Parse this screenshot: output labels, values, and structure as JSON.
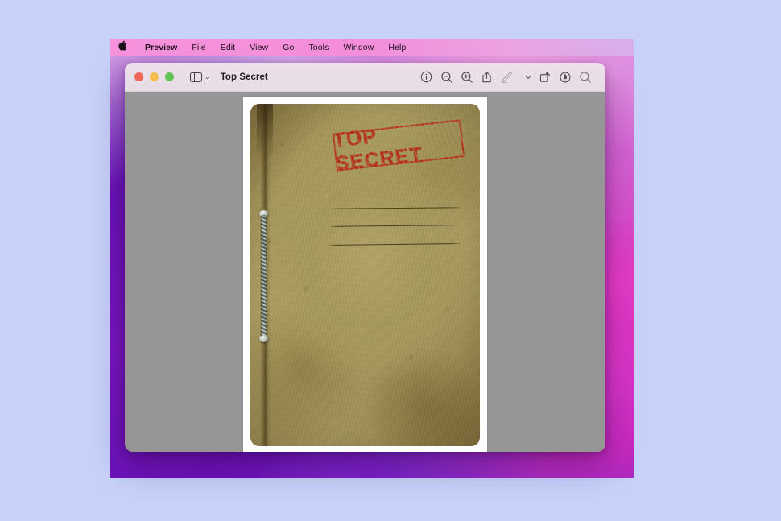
{
  "desktop": {
    "wallpaper_colors": {
      "outer_background": "#c7d1f9",
      "magenta": "#e03fd0",
      "violet": "#7a1cc6",
      "pink": "#f6a8e6"
    }
  },
  "menubar": {
    "apple_icon": "apple-logo-icon",
    "apple_glyph": "",
    "items": [
      {
        "label": "Preview",
        "bold": true
      },
      {
        "label": "File",
        "bold": false
      },
      {
        "label": "Edit",
        "bold": false
      },
      {
        "label": "View",
        "bold": false
      },
      {
        "label": "Go",
        "bold": false
      },
      {
        "label": "Tools",
        "bold": false
      },
      {
        "label": "Window",
        "bold": false
      },
      {
        "label": "Help",
        "bold": false
      }
    ]
  },
  "window": {
    "title": "Top Secret",
    "traffic_lights": {
      "close": "#f2655a",
      "minimize": "#f6bd4f",
      "zoom": "#61c454"
    },
    "sidebar_toggle": {
      "icon": "sidebar-icon",
      "chevron": "chevron-down-icon",
      "chevron_glyph": "⌄"
    },
    "toolbar": [
      {
        "name": "info-icon",
        "label": "Info",
        "disabled": false
      },
      {
        "name": "zoom-out-icon",
        "label": "Zoom Out",
        "disabled": false
      },
      {
        "name": "zoom-in-icon",
        "label": "Zoom In",
        "disabled": false
      },
      {
        "name": "share-icon",
        "label": "Share",
        "disabled": false
      },
      {
        "name": "markup-pen-icon",
        "label": "Markup",
        "disabled": true
      },
      {
        "name": "chevron-down-icon",
        "label": "More",
        "disabled": false
      },
      {
        "name": "rotate-icon",
        "label": "Rotate",
        "disabled": false
      },
      {
        "name": "annotate-icon",
        "label": "Annotate",
        "disabled": false
      },
      {
        "name": "search-icon",
        "label": "Search",
        "disabled": false
      }
    ],
    "viewer_background": "#969696"
  },
  "document": {
    "page_background": "#ffffff",
    "parchment_color": "#a89a5f",
    "stamp": {
      "text": "TOP SECRET",
      "color": "#b7231a",
      "rotation_deg": -6.4
    },
    "ruled_lines": 3,
    "binding": {
      "name": "spiral-binding",
      "type": "metal-coil"
    }
  }
}
